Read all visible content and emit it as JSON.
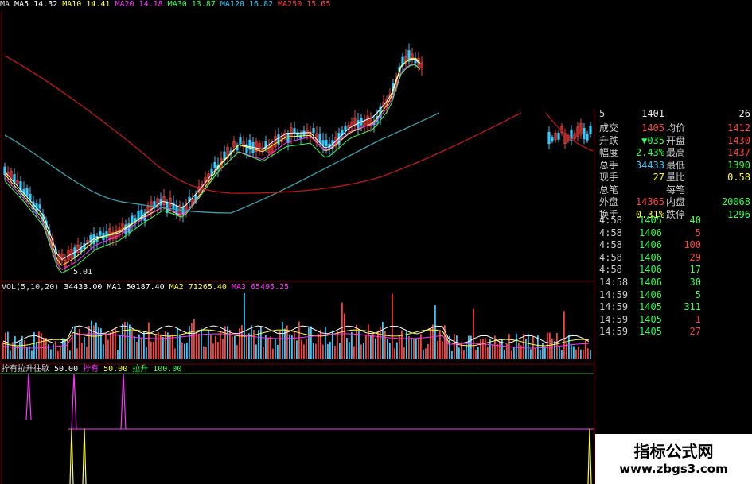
{
  "ma_legend": [
    {
      "label": "MA",
      "color": "#dddddd"
    },
    {
      "label": "MA5 14.32",
      "color": "#ffffff"
    },
    {
      "label": "MA10 14.41",
      "color": "#ffff33"
    },
    {
      "label": "MA20 14.18",
      "color": "#ff33ff"
    },
    {
      "label": "MA30 13.87",
      "color": "#33ff55"
    },
    {
      "label": "MA120 16.82",
      "color": "#33ccff"
    },
    {
      "label": "MA250 15.65",
      "color": "#ff4040"
    }
  ],
  "price_chart": {
    "low_label": "5.01"
  },
  "vol_legend": [
    {
      "label": "VOL(5,10,20)",
      "color": "#dddddd"
    },
    {
      "label": "34433.00",
      "color": "#ffffff"
    },
    {
      "label": "MA1 50187.40",
      "color": "#ffffff"
    },
    {
      "label": "MA2 71265.40",
      "color": "#ffff33"
    },
    {
      "label": "MA3 65495.25",
      "color": "#ff33ff"
    }
  ],
  "ind_legend": [
    {
      "label": "拧有拉升往歇",
      "color": "#dddddd"
    },
    {
      "label": "50.00",
      "color": "#ffffff"
    },
    {
      "label": "拧有",
      "color": "#ff33ff"
    },
    {
      "label": "50.00",
      "color": "#ffff33"
    },
    {
      "label": "拉升",
      "color": "#33ff55"
    },
    {
      "label": "100.00",
      "color": "#33ff55"
    }
  ],
  "quote": {
    "top_row": {
      "a": "5",
      "b": "1401",
      "c": "26"
    },
    "rows": [
      {
        "l1": "成交",
        "v1": "1405",
        "c1": "red",
        "l2": "均价",
        "v2": "1412",
        "c2": "red"
      },
      {
        "l1": "升跌",
        "v1": "▼035",
        "c1": "green",
        "l2": "开盘",
        "v2": "1430",
        "c2": "red"
      },
      {
        "l1": "幅度",
        "v1": "2.43%",
        "c1": "green",
        "l2": "最高",
        "v2": "1437",
        "c2": "red"
      },
      {
        "l1": "总手",
        "v1": "34433",
        "c1": "cyan",
        "l2": "最低",
        "v2": "1390",
        "c2": "green"
      },
      {
        "l1": "现手",
        "v1": "27",
        "c1": "yellow",
        "l2": "量比",
        "v2": "0.58",
        "c2": "yellow"
      },
      {
        "l1": "总笔",
        "v1": "",
        "c1": "white",
        "l2": "每笔",
        "v2": "",
        "c2": "white"
      },
      {
        "l1": "外盘",
        "v1": "14365",
        "c1": "red",
        "l2": "内盘",
        "v2": "20068",
        "c2": "green"
      },
      {
        "l1": "换手",
        "v1": "0.31%",
        "c1": "yellow",
        "l2": "跌停",
        "v2": "1296",
        "c2": "green"
      }
    ],
    "ticks": [
      {
        "t": "4:58",
        "p": "1405",
        "q": "40",
        "c": "green"
      },
      {
        "t": "4:58",
        "p": "1406",
        "q": "5",
        "c": "red"
      },
      {
        "t": "4:58",
        "p": "1406",
        "q": "100",
        "c": "red"
      },
      {
        "t": "4:58",
        "p": "1406",
        "q": "29",
        "c": "red"
      },
      {
        "t": "4:58",
        "p": "1406",
        "q": "17",
        "c": "green"
      },
      {
        "t": "14:58",
        "p": "1406",
        "q": "30",
        "c": "green"
      },
      {
        "t": "14:59",
        "p": "1406",
        "q": "5",
        "c": "green"
      },
      {
        "t": "14:59",
        "p": "1405",
        "q": "311",
        "c": "green"
      },
      {
        "t": "14:59",
        "p": "1405",
        "q": "1",
        "c": "red"
      },
      {
        "t": "14:59",
        "p": "1405",
        "q": "27",
        "c": "red"
      }
    ]
  },
  "watermark": {
    "title": "指标公式网",
    "url": "www.zbgs3.com"
  },
  "colors": {
    "up": "#ff4040",
    "down": "#33ccff",
    "ma5": "#ffffff",
    "ma10": "#ffff33",
    "ma20": "#ff33ff",
    "ma30": "#33ff55",
    "ma120": "#3aa0b0",
    "ma250": "#c01818",
    "frame": "#7a0000"
  }
}
